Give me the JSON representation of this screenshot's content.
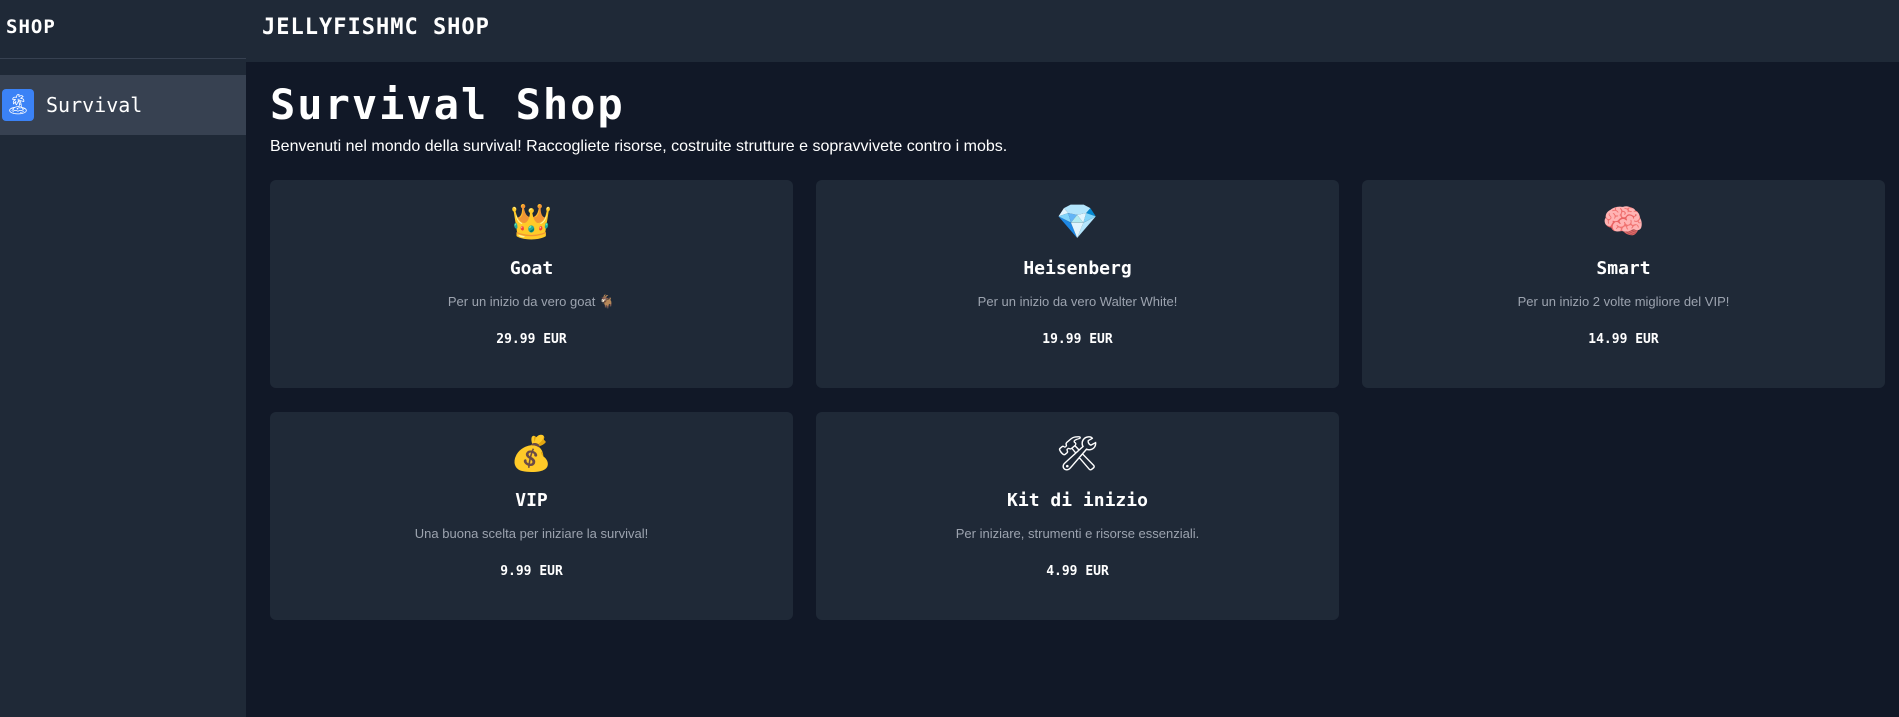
{
  "sidebar": {
    "title": "SHOP",
    "items": [
      {
        "label": "Survival",
        "icon": "palm-tree-icon",
        "icon_glyph": "🏝"
      }
    ]
  },
  "topbar": {
    "title": "JELLYFISHMC SHOP"
  },
  "page": {
    "title": "Survival Shop",
    "subtitle": "Benvenuti nel mondo della survival! Raccogliete risorse, costruite strutture e sopravvivete contro i mobs."
  },
  "products": [
    {
      "icon": "crown-icon",
      "icon_glyph": "👑",
      "title": "Goat",
      "description": "Per un inizio da vero goat 🐐",
      "price": "29.99 EUR"
    },
    {
      "icon": "diamond-icon",
      "icon_glyph": "💎",
      "title": "Heisenberg",
      "description": "Per un inizio da vero Walter White!",
      "price": "19.99 EUR"
    },
    {
      "icon": "brain-icon",
      "icon_glyph": "🧠",
      "title": "Smart",
      "description": "Per un inizio 2 volte migliore del VIP!",
      "price": "14.99 EUR"
    },
    {
      "icon": "money-bag-icon",
      "icon_glyph": "💰",
      "title": "VIP",
      "description": "Una buona scelta per iniziare la survival!",
      "price": "9.99 EUR"
    },
    {
      "icon": "hammer-wrench-icon",
      "icon_glyph": "🛠",
      "title": "Kit di inizio",
      "description": "Per iniziare, strumenti e risorse essenziali.",
      "price": "4.99 EUR"
    }
  ],
  "colors": {
    "background": "#111827",
    "panel": "#1f2937",
    "active_item": "#374151",
    "accent": "#3b82f6",
    "muted_text": "#9ca3af"
  }
}
